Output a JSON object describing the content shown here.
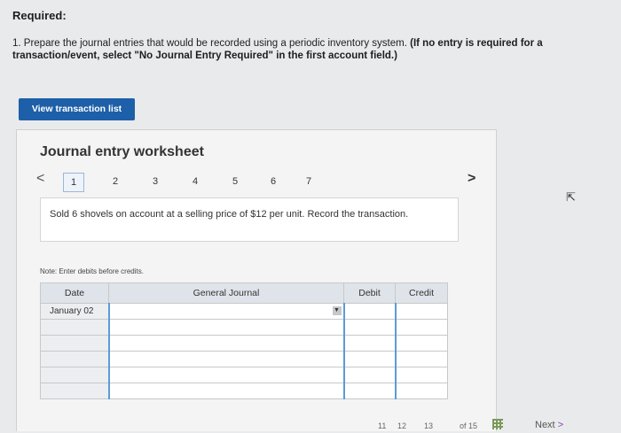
{
  "header": {
    "required_label": "Required:",
    "instruction_main": "1. Prepare the journal entries that would be recorded using a periodic inventory system.",
    "instruction_bold": "(If no entry is required for a transaction/event, select \"No Journal Entry Required\" in the first account field.)"
  },
  "view_button_label": "View transaction list",
  "worksheet": {
    "title": "Journal entry worksheet",
    "prev_icon": "<",
    "next_icon": ">",
    "pages": [
      "1",
      "2",
      "3",
      "4",
      "5",
      "6",
      "7"
    ],
    "active_page": "1",
    "transaction_text": "Sold 6 shovels on account at a selling price of $12 per unit. Record the transaction.",
    "note": "Note: Enter debits before credits.",
    "columns": {
      "date": "Date",
      "account": "General Journal",
      "debit": "Debit",
      "credit": "Credit"
    },
    "rows": [
      {
        "date": "January 02",
        "account": "",
        "debit": "",
        "credit": ""
      },
      {
        "date": "",
        "account": "",
        "debit": "",
        "credit": ""
      },
      {
        "date": "",
        "account": "",
        "debit": "",
        "credit": ""
      },
      {
        "date": "",
        "account": "",
        "debit": "",
        "credit": ""
      },
      {
        "date": "",
        "account": "",
        "debit": "",
        "credit": ""
      },
      {
        "date": "",
        "account": "",
        "debit": "",
        "credit": ""
      }
    ]
  },
  "footer": {
    "page_numbers": [
      "11",
      "12",
      "13"
    ],
    "of_total": "of 15",
    "next_label": "Next",
    "next_icon": ">"
  }
}
